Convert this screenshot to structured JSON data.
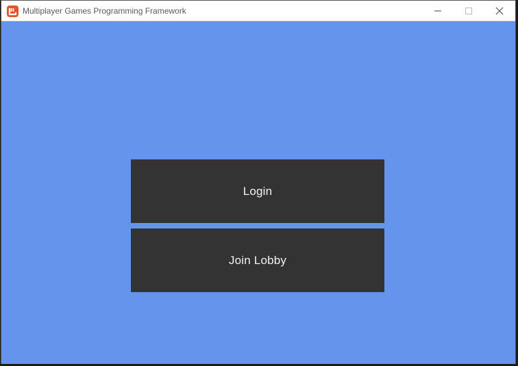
{
  "window": {
    "title": "Multiplayer Games Programming Framework",
    "icon": "monogame-logo-icon",
    "controls": {
      "minimize": "minimize-icon",
      "maximize": "maximize-icon",
      "close": "close-icon"
    }
  },
  "colors": {
    "background": "#6495ed",
    "button": "#333333",
    "button_text": "#f2f2f2",
    "icon_accent": "#e7522b"
  },
  "menu": {
    "login_label": "Login",
    "join_lobby_label": "Join Lobby"
  }
}
